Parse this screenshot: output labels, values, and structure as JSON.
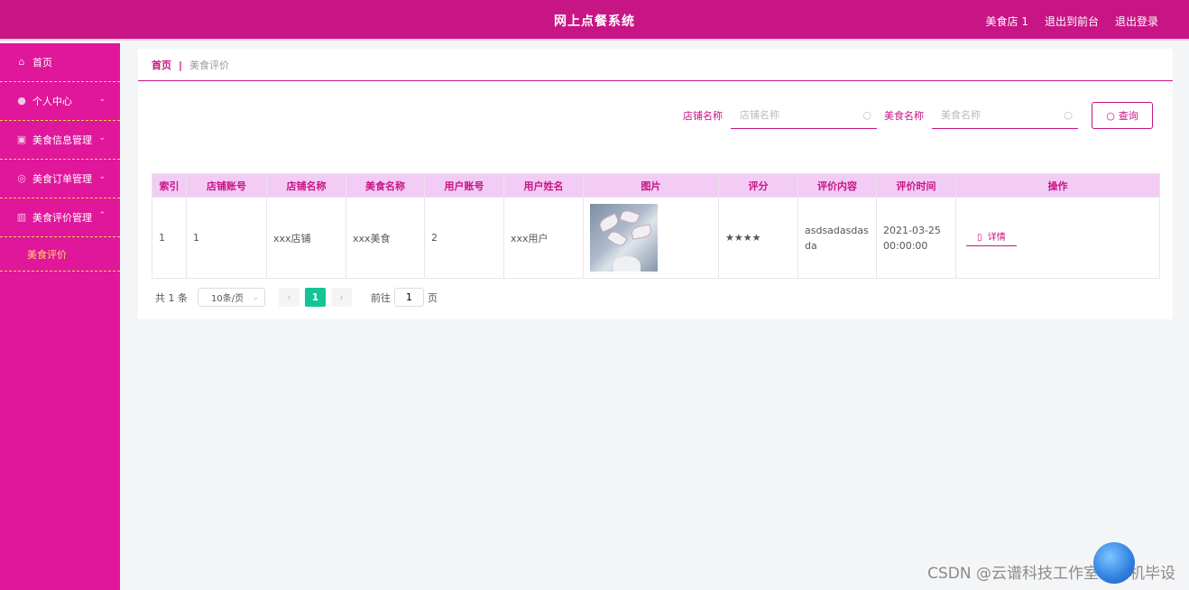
{
  "header": {
    "title": "网上点餐系统",
    "links": [
      "美食店 1",
      "退出到前台",
      "退出登录"
    ]
  },
  "sidebar": {
    "items": [
      {
        "label": "首页",
        "icon": "home-icon",
        "chevron": ""
      },
      {
        "label": "个人中心",
        "icon": "user-icon",
        "chevron": "⌄"
      },
      {
        "label": "美食信息管理",
        "icon": "clipboard-icon",
        "chevron": "⌄"
      },
      {
        "label": "美食订单管理",
        "icon": "compass-icon",
        "chevron": "⌄"
      },
      {
        "label": "美食评价管理",
        "icon": "chart-icon",
        "chevron": "⌃"
      }
    ],
    "subitem": "美食评价"
  },
  "breadcrumb": {
    "home": "首页",
    "separator": "|",
    "current": "美食评价"
  },
  "search": {
    "shop_label": "店铺名称",
    "shop_placeholder": "店铺名称",
    "food_label": "美食名称",
    "food_placeholder": "美食名称",
    "button": "查询"
  },
  "table": {
    "headers": [
      "索引",
      "店铺账号",
      "店铺名称",
      "美食名称",
      "用户账号",
      "用户姓名",
      "图片",
      "评分",
      "评价内容",
      "评价时间",
      "操作"
    ],
    "rows": [
      {
        "index": "1",
        "shop_account": "1",
        "shop_name": "xxx店铺",
        "food_name": "xxx美食",
        "user_account": "2",
        "user_name": "xxx用户",
        "rating": "★★★★",
        "content": "asdsadasdasda",
        "time": "2021-03-25 00:00:00",
        "action": "详情"
      }
    ]
  },
  "pager": {
    "total": "共 1 条",
    "page_size": "10条/页",
    "prev": "‹",
    "current": "1",
    "next": "›",
    "goto_label": "前往",
    "goto_value": "1",
    "page_suffix": "页"
  },
  "watermark": "CSDN @云谱科技工作室计算机毕设",
  "colors": {
    "primary": "#c71585",
    "sidebar": "#e0169b",
    "header_bg": "#f3ccf5",
    "pager_active": "#13c494"
  }
}
